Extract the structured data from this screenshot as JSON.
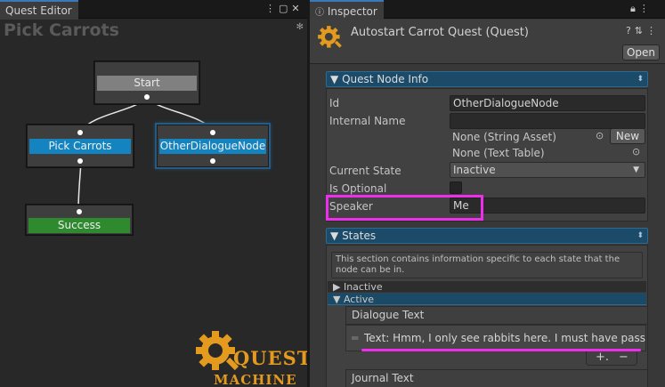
{
  "left_panel": {
    "tab_label": "Quest Editor",
    "tab_menu_icon": "kebab-menu-icon",
    "tab_maximize_icon": "maximize-icon",
    "tab_close_icon": "close-icon",
    "canvas_title": "Pick Carrots",
    "canvas_gear_icon": "gear-icon",
    "nodes": {
      "start": "Start",
      "pick_carrots": "Pick Carrots",
      "other_dialogue": "OtherDialogueNode",
      "success": "Success"
    },
    "logo": {
      "line1": "QUEST",
      "line2": "MACHINE"
    }
  },
  "inspector": {
    "tab_label": "Inspector",
    "quest_title": "Autostart Carrot Quest (Quest)",
    "open_button": "Open",
    "header_icons": [
      "help-icon",
      "settings-icon",
      "menu-icon"
    ],
    "quest_node_info": {
      "section_title": "Quest Node Info",
      "fields": {
        "id_label": "Id",
        "id_value": "OtherDialogueNode",
        "internal_name_label": "Internal Name",
        "internal_name_value": "",
        "string_asset_value": "None (String Asset)",
        "new_button": "New",
        "text_table_value": "None (Text Table)",
        "current_state_label": "Current State",
        "current_state_value": "Inactive",
        "is_optional_label": "Is Optional",
        "speaker_label": "Speaker",
        "speaker_value": "Me"
      }
    },
    "states": {
      "section_title": "States",
      "description": "This section contains information specific to each state that the node can be in.",
      "inactive_label": "Inactive",
      "active_label": "Active",
      "dialogue_text_label": "Dialogue Text",
      "dialogue_item": "Text: Hmm, I only see rabbits here. I must have passed b",
      "add_button": "+.",
      "remove_button": "−",
      "journal_text_label": "Journal Text"
    }
  },
  "colors": {
    "highlight": "#ef2ded",
    "node_selected_blue": "#1484c0",
    "success_green": "#2f8a2f",
    "section_blue": "#1b4b69",
    "logo_orange": "#e39a1e"
  }
}
